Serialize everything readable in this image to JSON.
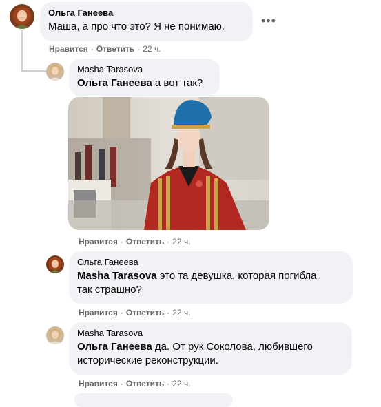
{
  "actions": {
    "like": "Нравится",
    "reply": "Ответить",
    "dot": "·"
  },
  "comments": [
    {
      "author": "Ольга Ганеева",
      "mention": "",
      "text": "Маша, а про что это? Я не понимаю.",
      "time": "22 ч."
    },
    {
      "author": "Masha Tarasova",
      "mention": "Ольга Ганеева",
      "text": "а вот так?",
      "time": "22 ч."
    },
    {
      "author": "Ольга Ганеева",
      "mention": "Masha Tarasova",
      "text_line1": "это та девушка, которая погибла",
      "text_line2": "так страшно?",
      "time": "22 ч."
    },
    {
      "author": "Masha Tarasova",
      "mention": "Ольга Ганеева",
      "text_line1": "да. От рук Соколова, любившего",
      "text_line2": "исторические реконструкции.",
      "time": "22 ч."
    }
  ],
  "icons": {
    "more": "more-options-icon"
  }
}
